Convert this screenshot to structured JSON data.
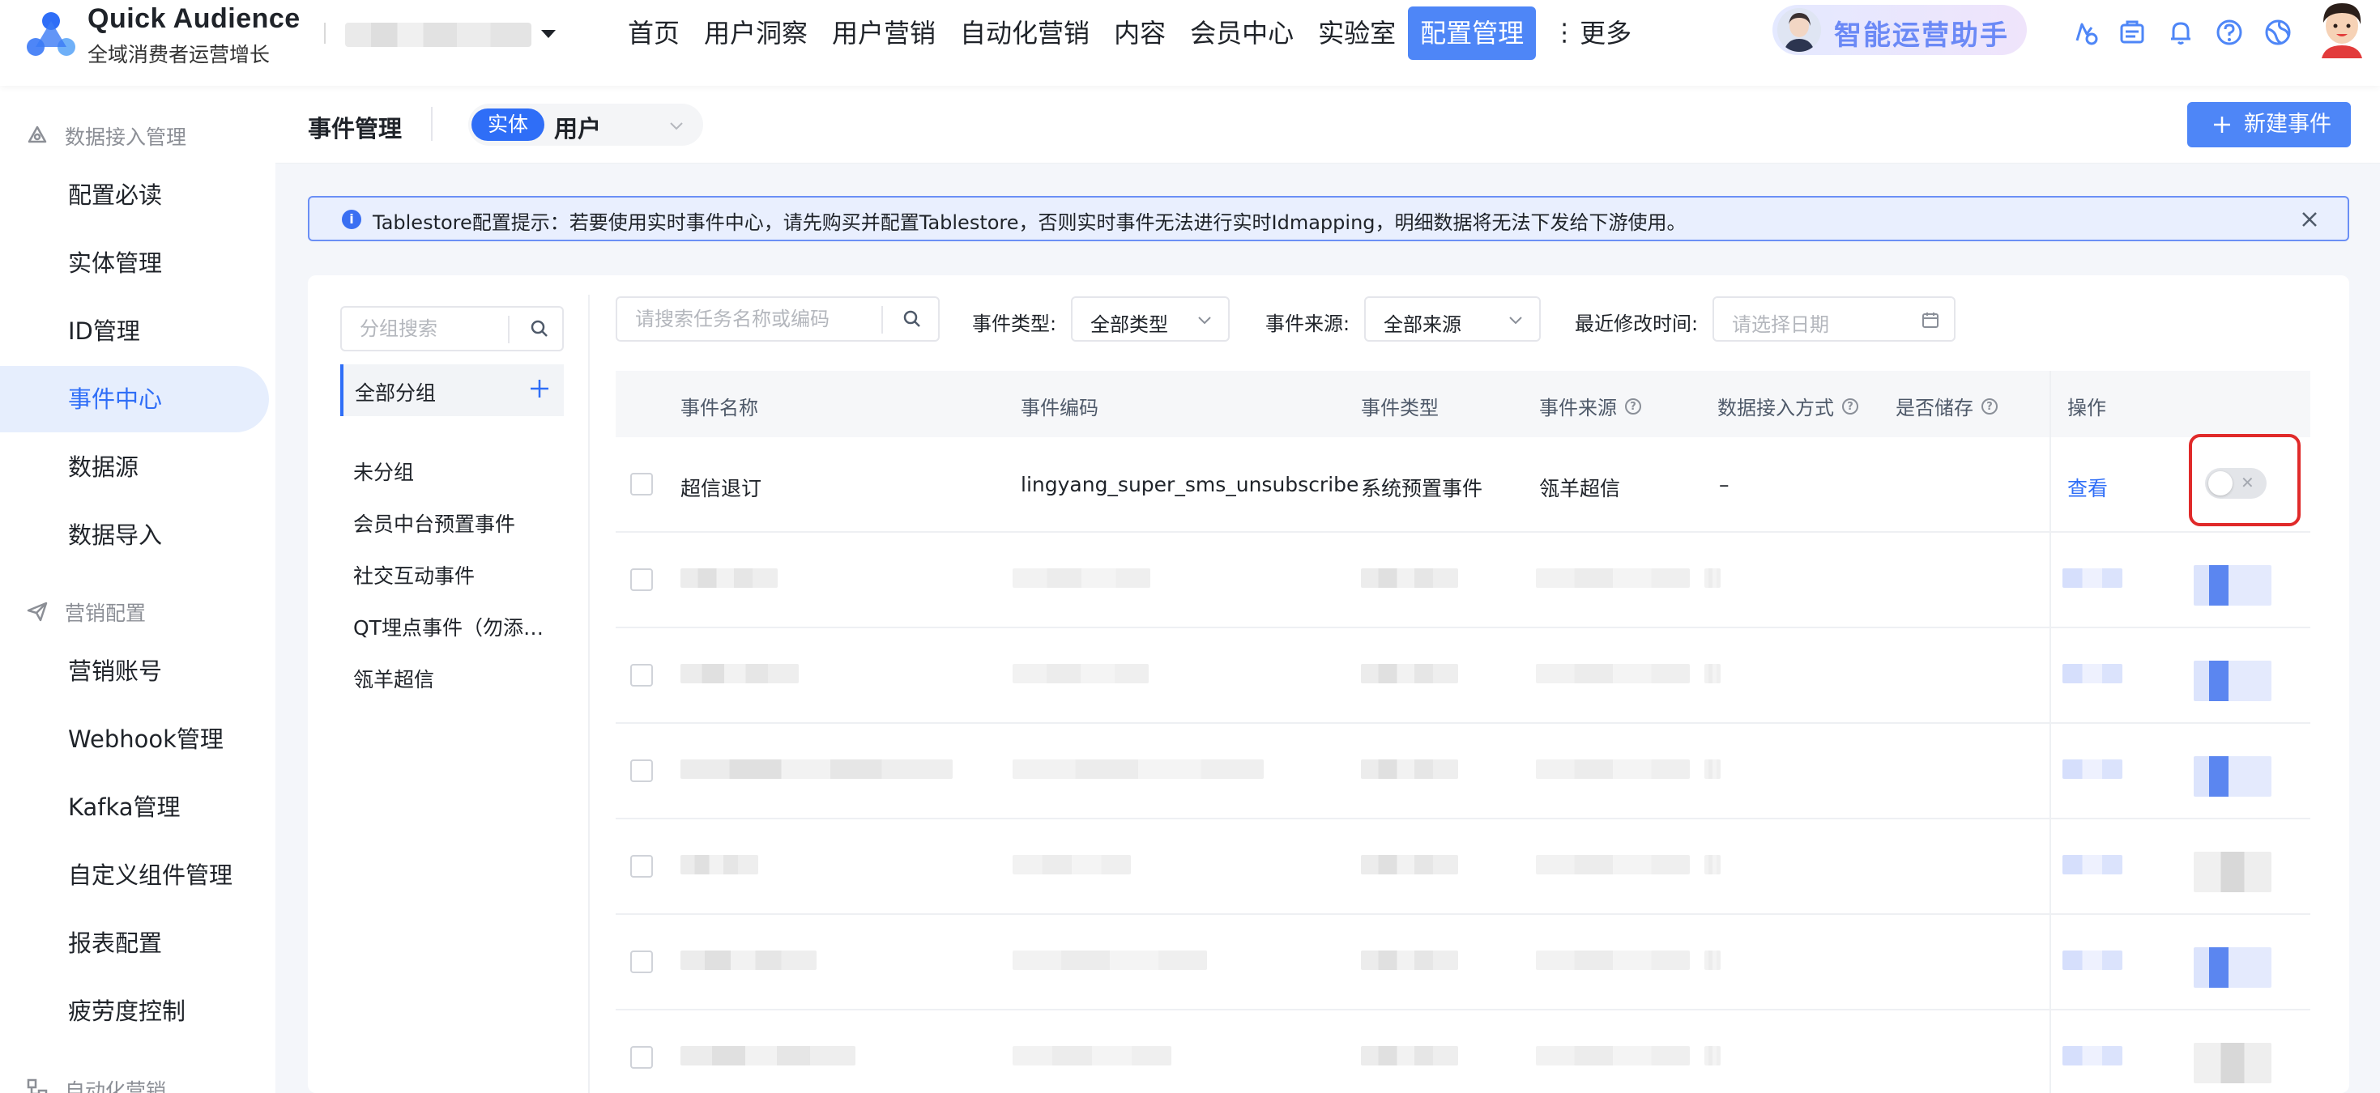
{
  "brand": {
    "name": "Quick Audience",
    "subtitle": "全域消费者运营增长"
  },
  "nav": [
    "首页",
    "用户洞察",
    "用户营销",
    "自动化营销",
    "内容",
    "会员中心",
    "实验室",
    "配置管理",
    "更多"
  ],
  "nav_active": "配置管理",
  "assistant_label": "智能运营助手",
  "sidebar": {
    "groups": [
      {
        "label": "数据接入管理",
        "icon": "database-icon",
        "items": [
          "配置必读",
          "实体管理",
          "ID管理",
          "事件中心",
          "数据源",
          "数据导入"
        ]
      },
      {
        "label": "营销配置",
        "icon": "send-icon",
        "items": [
          "营销账号",
          "Webhook管理",
          "Kafka管理",
          "自定义组件管理",
          "报表配置",
          "疲劳度控制"
        ]
      },
      {
        "label": "自动化营销",
        "icon": "flow-icon",
        "items": []
      }
    ],
    "active_item": "事件中心"
  },
  "header": {
    "title": "事件管理",
    "entity_tag": "实体",
    "entity_value": "用户",
    "new_button": "新建事件"
  },
  "alert": {
    "message": "Tablestore配置提示：若要使用实时事件中心，请先购买并配置Tablestore，否则实时事件无法进行实时Idmapping，明细数据将无法下发给下游使用。"
  },
  "groups_panel": {
    "search_placeholder": "分组搜索",
    "all_label": "全部分组",
    "items": [
      "未分组",
      "会员中台预置事件",
      "社交互动事件",
      "QT埋点事件（勿添…",
      "瓴羊超信"
    ]
  },
  "filters": {
    "search_placeholder": "请搜索任务名称或编码",
    "type_label": "事件类型:",
    "type_value": "全部类型",
    "source_label": "事件来源:",
    "source_value": "全部来源",
    "time_label": "最近修改时间:",
    "time_placeholder": "请选择日期"
  },
  "table": {
    "columns": [
      "事件名称",
      "事件编码",
      "事件类型",
      "事件来源",
      "数据接入方式",
      "是否储存",
      "操作"
    ],
    "rows": [
      {
        "name": "超信退订",
        "code": "lingyang_super_sms_unsubscribe",
        "type": "系统预置事件",
        "source": "瓴羊超信",
        "access": "–",
        "stored": false,
        "action": "查看"
      }
    ]
  },
  "colors": {
    "primary": "#4e86f7",
    "active_text": "#2f6ef7",
    "highlight": "#e02a2a",
    "alert_bg": "#e9effe"
  }
}
